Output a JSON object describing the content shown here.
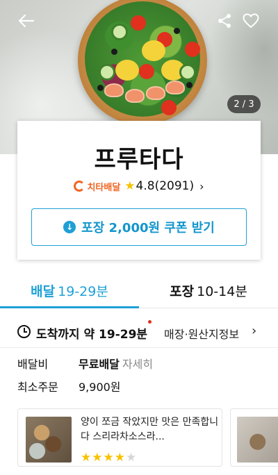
{
  "hero": {
    "image_page_indicator": "2 / 3",
    "icons": {
      "back": "arrow-left-icon",
      "share": "share-icon",
      "favorite": "heart-outline-icon"
    }
  },
  "store": {
    "name": "프루타다",
    "platform_badge": "치타배달",
    "rating": "4.8(2091)",
    "coupon_label": "포장 2,000원 쿠폰 받기"
  },
  "tabs": {
    "delivery": {
      "label": "배달",
      "time": "19-29분"
    },
    "takeout": {
      "label": "포장",
      "time": "10-14분"
    }
  },
  "arrival": {
    "text": "도착까지 약 19-29분",
    "origin_link": "매장·원산지정보"
  },
  "fees": {
    "delivery_fee_label": "배달비",
    "delivery_fee_value": "무료배달",
    "delivery_fee_detail": "자세히",
    "min_order_label": "최소주문",
    "min_order_value": "9,900원"
  },
  "reviews": [
    {
      "text": "양이 쪼금 작았지만 맛은 만족합니다 스리라차소스라...",
      "rating": 4,
      "max": 5
    }
  ],
  "colors": {
    "accent": "#1ea0d6",
    "brand_orange": "#f26522",
    "star": "#f7c200"
  }
}
